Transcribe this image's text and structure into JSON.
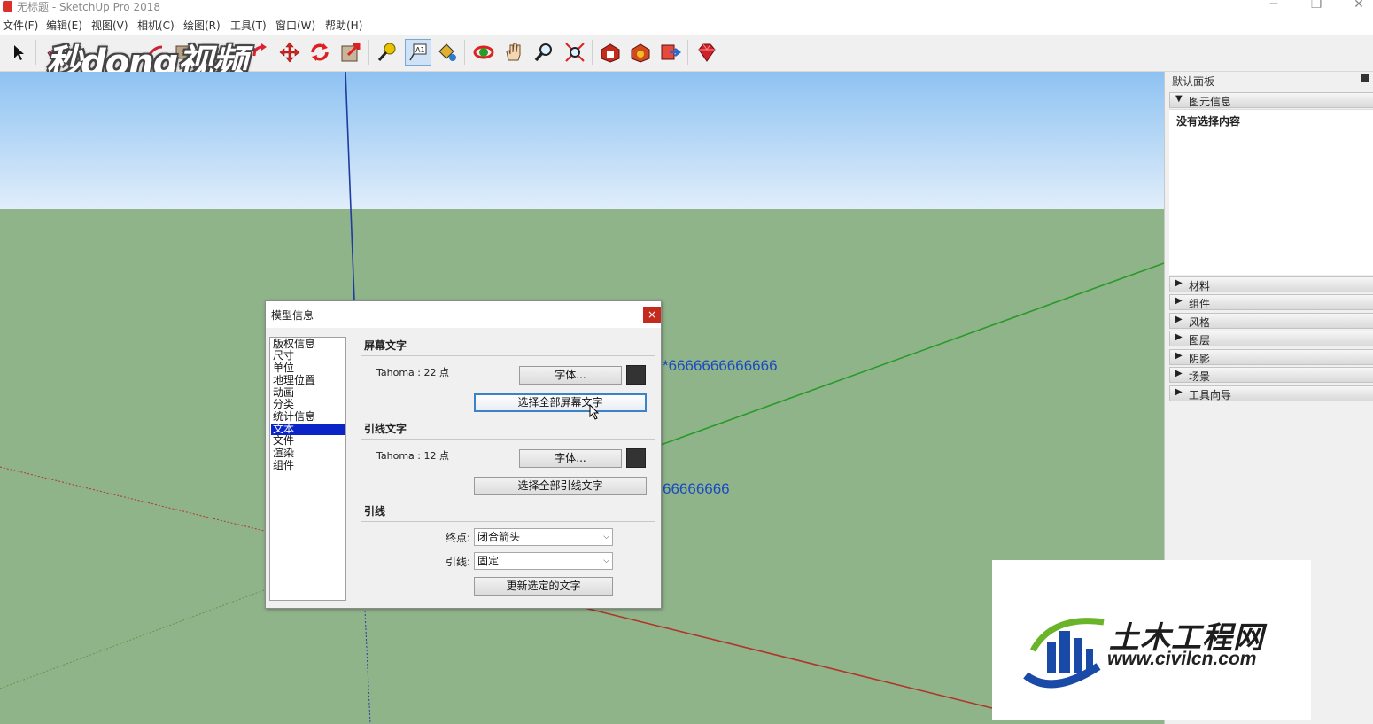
{
  "window": {
    "title": "无标题 - SketchUp Pro 2018",
    "controls": {
      "minimize": "─",
      "restore": "❐",
      "close": "✕"
    }
  },
  "menu": [
    "文件(F)",
    "编辑(E)",
    "视图(V)",
    "相机(C)",
    "绘图(R)",
    "工具(T)",
    "窗口(W)",
    "帮助(H)"
  ],
  "toolbar": {
    "tools": [
      "select-icon",
      "eraser-icon",
      "paint-icon",
      "rectangle-icon",
      "move-icon",
      "rotate-icon",
      "scale-icon",
      "tape-measure-icon",
      "text-tool-icon",
      "paint-bucket-icon",
      "orbit-icon",
      "pan-icon",
      "zoom-icon",
      "zoom-extents-icon",
      "warehouse-icon",
      "extension-icon",
      "send-icon",
      "ruby-icon"
    ],
    "active_tool": "text-tool-icon"
  },
  "overlay_logo": "秒dong视频",
  "scene": {
    "text_1": "*6666666666666",
    "text_2": "66666666"
  },
  "panel": {
    "title": "默认面板",
    "entity_section": "图元信息",
    "no_selection": "没有选择内容",
    "sections": [
      "材料",
      "组件",
      "风格",
      "图层",
      "阴影",
      "场景",
      "工具向导"
    ]
  },
  "dialog": {
    "title": "模型信息",
    "close": "×",
    "categories": [
      "版权信息",
      "尺寸",
      "单位",
      "地理位置",
      "动画",
      "分类",
      "统计信息",
      "文本",
      "文件",
      "渲染",
      "组件"
    ],
    "selected_category": "文本",
    "screen_text": {
      "heading": "屏幕文字",
      "font_info": "Tahoma : 22 点",
      "font_button": "字体...",
      "select_all_button": "选择全部屏幕文字"
    },
    "leader_text": {
      "heading": "引线文字",
      "font_info": "Tahoma : 12 点",
      "font_button": "字体...",
      "select_all_button": "选择全部引线文字"
    },
    "leader": {
      "heading": "引线",
      "endpoint_label": "终点:",
      "endpoint_value": "闭合箭头",
      "leader_label": "引线:",
      "leader_value": "固定",
      "update_button": "更新选定的文字"
    }
  },
  "watermark": {
    "name": "土木工程网",
    "url": "www.civilcn.com"
  },
  "colors": {
    "sky_top": "#8ec2f2",
    "ground": "#90b48a",
    "axis_blue": "#1f3aa0",
    "axis_green": "#2a9a2a",
    "axis_red": "#b0362a",
    "selection": "#0a24c8",
    "close_red": "#c42b1c"
  }
}
